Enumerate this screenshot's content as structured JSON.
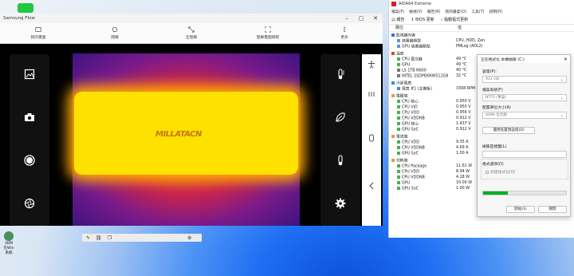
{
  "desktop": {
    "icons": [
      {
        "name": "line-icon",
        "color": "#1fc742"
      },
      {
        "name": "app-icon-2",
        "color": "#2c7be5"
      },
      {
        "name": "app-icon-3",
        "color": "#7c5cd6"
      },
      {
        "name": "app-icon-4",
        "color": "#c03a2b"
      },
      {
        "name": "app-icon-5",
        "color": "#4b8f5c"
      }
    ],
    "bottom_labels": [
      "3DM",
      "在Win",
      "系統"
    ]
  },
  "flow": {
    "title": "Samsung Flow",
    "toolbar": [
      {
        "label": "我的畫面",
        "icon": "home-icon"
      },
      {
        "label": "開機",
        "icon": "rotate-icon"
      },
      {
        "label": "全螢幕",
        "icon": "fullscreen-icon"
      },
      {
        "label": "螢幕畫面擷取",
        "icon": "screenshot-icon"
      },
      {
        "label": "更多",
        "icon": "more-icon"
      }
    ],
    "thermal_brand": "MILLATACN"
  },
  "aida": {
    "title": "AIDA64 Extreme",
    "menu": [
      "檔案(F)",
      "檢視(V)",
      "報告(R)",
      "我的最愛(O)",
      "工具(T)",
      "說明(H)"
    ],
    "toolbar": [
      "報告",
      "BIOS 更新",
      "驅動程式更新"
    ],
    "columns": [
      "欄位",
      "值"
    ],
    "tree": [
      {
        "label": "監視器內容",
        "value": "",
        "group": true,
        "color": "#3a6fd8"
      },
      {
        "label": "感應器類型",
        "value": "CPU, HDD, Zen",
        "group": false,
        "color": "#6b8fd9"
      },
      {
        "label": "GPU 感應器類型",
        "value": "PMLog (ADL2)",
        "group": false,
        "color": "#6b8fd9"
      },
      {
        "label": "溫度",
        "value": "",
        "group": true,
        "color": "#d84a3a"
      },
      {
        "label": "CPU 直交器",
        "value": "49 °C",
        "group": false,
        "color": "#4caf50"
      },
      {
        "label": "GPU",
        "value": "49 °C",
        "group": false,
        "color": "#4caf50"
      },
      {
        "label": "LS 1TB N600",
        "value": "40 °C",
        "group": false,
        "color": "#777777"
      },
      {
        "label": "INTEL SSDPEKNW512G8",
        "value": "32 °C",
        "group": false,
        "color": "#777777"
      },
      {
        "label": "冷卻風扇",
        "value": "",
        "group": true,
        "color": "#3a8fd8"
      },
      {
        "label": "風扇 #1 (主機板)",
        "value": "3308 RPM",
        "group": false,
        "color": "#3a8fd8"
      },
      {
        "label": "電壓值",
        "value": "",
        "group": true,
        "color": "#d8a23a"
      },
      {
        "label": "CPU 核心",
        "value": "0.950 V",
        "group": false,
        "color": "#4caf50"
      },
      {
        "label": "CPU VID",
        "value": "0.950 V",
        "group": false,
        "color": "#4caf50"
      },
      {
        "label": "CPU VDD",
        "value": "0.956 V",
        "group": false,
        "color": "#4caf50"
      },
      {
        "label": "CPU VDDNB",
        "value": "0.912 V",
        "group": false,
        "color": "#4caf50"
      },
      {
        "label": "GPU 核心",
        "value": "1.437 V",
        "group": false,
        "color": "#4caf50"
      },
      {
        "label": "GPU SoC",
        "value": "0.912 V",
        "group": false,
        "color": "#4caf50"
      },
      {
        "label": "電流值",
        "value": "",
        "group": true,
        "color": "#d8a23a"
      },
      {
        "label": "CPU VDD",
        "value": "9.35 A",
        "group": false,
        "color": "#4caf50"
      },
      {
        "label": "CPU VDDNB",
        "value": "4.69 A",
        "group": false,
        "color": "#4caf50"
      },
      {
        "label": "GPU SoC",
        "value": "1.00 A",
        "group": false,
        "color": "#4caf50"
      },
      {
        "label": "功耗值",
        "value": "",
        "group": true,
        "color": "#d8a23a"
      },
      {
        "label": "CPU Package",
        "value": "11.61 W",
        "group": false,
        "color": "#4caf50"
      },
      {
        "label": "CPU VDD",
        "value": "8.94 W",
        "group": false,
        "color": "#4caf50"
      },
      {
        "label": "CPU VDDNB",
        "value": "4.28 W",
        "group": false,
        "color": "#4caf50"
      },
      {
        "label": "GPU",
        "value": "10.00 W",
        "group": false,
        "color": "#4caf50"
      },
      {
        "label": "GPU SoC",
        "value": "1.00 W",
        "group": false,
        "color": "#4caf50"
      }
    ]
  },
  "dialog": {
    "title": "正在格式化 本機磁碟 (C:)",
    "capacity_label": "容量(P):",
    "capacity_value": "931 GB",
    "fs_label": "檔案系統(F)",
    "fs_value": "NTFS (預設)",
    "alloc_label": "配置單位大小(A)",
    "alloc_value": "4096 位元組",
    "restore_btn": "還原裝置預設值(D)",
    "volume_label": "磁碟區標籤(L)",
    "format_options_label": "格式選項(O)",
    "quick_format_label": "快速格式化(Q)",
    "progress": 0.3,
    "start_btn": "開始(S)",
    "close_btn": "關閉"
  }
}
